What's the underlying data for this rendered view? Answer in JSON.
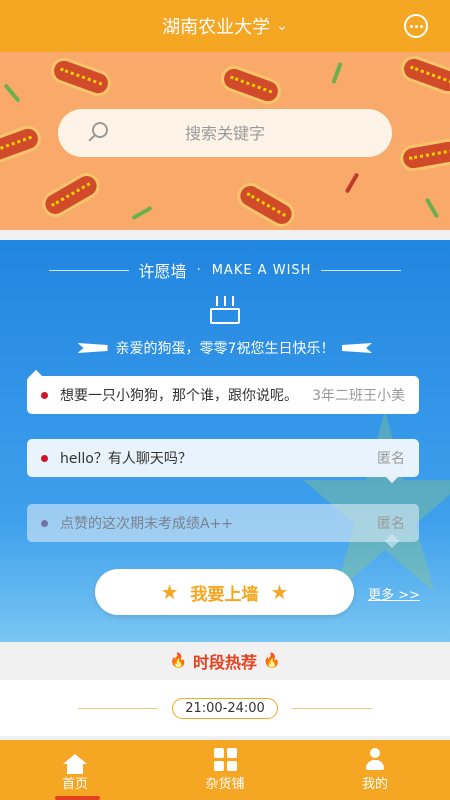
{
  "header": {
    "title": "湖南农业大学",
    "chevron_icon": "chevron-down-icon",
    "chat_icon": "chat-bubble-icon"
  },
  "search": {
    "placeholder": "搜索关键字",
    "icon": "search-icon"
  },
  "wish_wall": {
    "title_zh": "许愿墙",
    "separator": "·",
    "title_en": "MAKE A WISH",
    "cake_icon": "birthday-cake-icon",
    "birthday_message": "亲爱的狗蛋，零零7祝您生日快乐！",
    "messages": [
      {
        "text": "想要一只小狗狗，那个谁，跟你说呢。",
        "author": "3年二班王小美"
      },
      {
        "text": "hello？有人聊天吗？",
        "author": "匿名"
      },
      {
        "text": "点赞的这次期末考成绩A++",
        "author": "匿名"
      }
    ],
    "post_button": "我要上墙",
    "more_link": "更多 >>"
  },
  "hot_section": {
    "title": "时段热荐",
    "time_range": "21:00-24:00"
  },
  "tabbar": {
    "items": [
      {
        "label": "首页",
        "icon": "home-icon",
        "active": true
      },
      {
        "label": "杂货铺",
        "icon": "grid-icon",
        "active": false
      },
      {
        "label": "我的",
        "icon": "user-icon",
        "active": false
      }
    ]
  },
  "colors": {
    "brand": "#f5a623",
    "accent_red": "#e4411f",
    "wish_blue": "#2186e0"
  }
}
